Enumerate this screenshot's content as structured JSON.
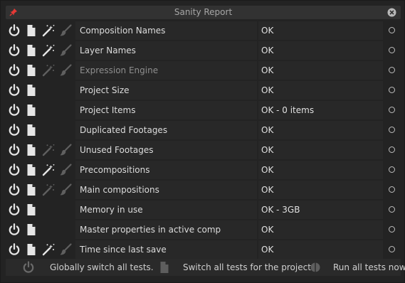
{
  "window": {
    "title": "Sanity Report"
  },
  "tests": [
    {
      "name": "Composition Names",
      "status": "OK",
      "has_fix": true,
      "fix_enabled": true,
      "name_dim": false
    },
    {
      "name": "Layer Names",
      "status": "OK",
      "has_fix": true,
      "fix_enabled": true,
      "name_dim": false
    },
    {
      "name": "Expression Engine",
      "status": "OK",
      "has_fix": true,
      "fix_enabled": false,
      "name_dim": true
    },
    {
      "name": "Project Size",
      "status": "OK",
      "has_fix": false,
      "fix_enabled": false,
      "name_dim": false
    },
    {
      "name": "Project Items",
      "status": "OK - 0 items",
      "has_fix": false,
      "fix_enabled": false,
      "name_dim": false
    },
    {
      "name": "Duplicated Footages",
      "status": "OK",
      "has_fix": false,
      "fix_enabled": false,
      "name_dim": false
    },
    {
      "name": "Unused Footages",
      "status": "OK",
      "has_fix": true,
      "fix_enabled": false,
      "name_dim": false
    },
    {
      "name": "Precompositions",
      "status": "OK",
      "has_fix": true,
      "fix_enabled": true,
      "name_dim": false
    },
    {
      "name": "Main compositions",
      "status": "OK",
      "has_fix": true,
      "fix_enabled": false,
      "name_dim": false
    },
    {
      "name": "Memory in use",
      "status": "OK - 3GB",
      "has_fix": false,
      "fix_enabled": false,
      "name_dim": false
    },
    {
      "name": "Master properties in active comp",
      "status": "OK",
      "has_fix": false,
      "fix_enabled": false,
      "name_dim": false
    },
    {
      "name": "Time since last save",
      "status": "OK",
      "has_fix": true,
      "fix_enabled": true,
      "name_dim": false
    }
  ],
  "footer": {
    "switch_all_label": "Globally switch all tests.",
    "switch_project_label": "Switch all tests for the project.",
    "run_all_label": "Run all tests now."
  },
  "colors": {
    "background": "#232323",
    "cell": "#282828",
    "icon": "#e6e6e6",
    "icon_dim": "#5f5f5f",
    "pin_red": "#e53935"
  }
}
